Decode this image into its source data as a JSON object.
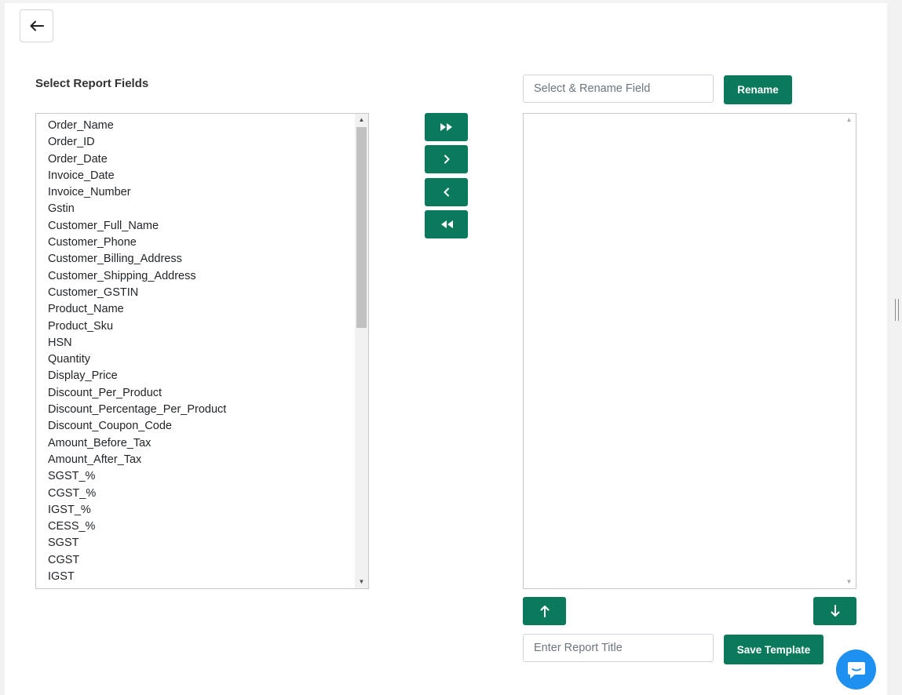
{
  "header": {
    "back_icon": "arrow-left-icon"
  },
  "left_panel": {
    "title": "Select Report Fields",
    "fields": [
      "Order_Name",
      "Order_ID",
      "Order_Date",
      "Invoice_Date",
      "Invoice_Number",
      "Gstin",
      "Customer_Full_Name",
      "Customer_Phone",
      "Customer_Billing_Address",
      "Customer_Shipping_Address",
      "Customer_GSTIN",
      "Product_Name",
      "Product_Sku",
      "HSN",
      "Quantity",
      "Display_Price",
      "Discount_Per_Product",
      "Discount_Percentage_Per_Product",
      "Discount_Coupon_Code",
      "Amount_Before_Tax",
      "Amount_After_Tax",
      "SGST_%",
      "CGST_%",
      "IGST_%",
      "CESS_%",
      "SGST",
      "CGST",
      "IGST"
    ]
  },
  "transfer_buttons": {
    "move_all_right_icon": "double-chevron-right-icon",
    "move_right_icon": "chevron-right-icon",
    "move_left_icon": "chevron-left-icon",
    "move_all_left_icon": "double-chevron-left-icon"
  },
  "right_panel": {
    "rename_placeholder": "Select & Rename Field",
    "rename_label": "Rename",
    "selected_fields": [],
    "move_up_icon": "arrow-up-icon",
    "move_down_icon": "arrow-down-icon",
    "report_title_placeholder": "Enter Report Title",
    "save_label": "Save Template"
  },
  "colors": {
    "accent": "#0b7a5c",
    "chat": "#1e90f0"
  },
  "chat_widget": {
    "icon": "chat-icon"
  }
}
